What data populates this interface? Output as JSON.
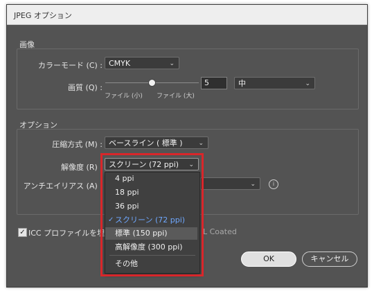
{
  "window": {
    "title": "JPEG オプション"
  },
  "image_section": {
    "heading": "画像",
    "color_mode_label": "カラーモード (C) :",
    "color_mode_value": "CMYK",
    "quality_label": "画質 (Q) :",
    "quality_value": "5",
    "quality_level": "中",
    "slider_left_label": "ファイル (小)",
    "slider_right_label": "ファイル (大)"
  },
  "options_section": {
    "heading": "オプション",
    "compression_label": "圧縮方式 (M) :",
    "compression_value": "ベースライン ( 標準 )",
    "resolution_label": "解像度 (R) :",
    "resolution_value": "スクリーン (72 ppi)",
    "antialias_label": "アンチエイリアス (A) :"
  },
  "icc": {
    "label": "ICC プロファイルを埋",
    "profile_fragment": "L Coated",
    "checked": true
  },
  "resolution_dropdown": {
    "items": [
      {
        "label": "4 ppi"
      },
      {
        "label": "18 ppi"
      },
      {
        "label": "36 ppi"
      },
      {
        "label": "スクリーン (72 ppi)"
      },
      {
        "label": "標準 (150 ppi)"
      },
      {
        "label": "高解像度 (300 ppi)"
      },
      {
        "label": "その他"
      }
    ],
    "selected_index": 3,
    "hover_index": 4
  },
  "buttons": {
    "ok": "OK",
    "cancel": "キャンセル"
  },
  "colors": {
    "dialog_bg": "#535353",
    "highlight_box": "#d9262a",
    "selected_text": "#6fa8ff"
  }
}
